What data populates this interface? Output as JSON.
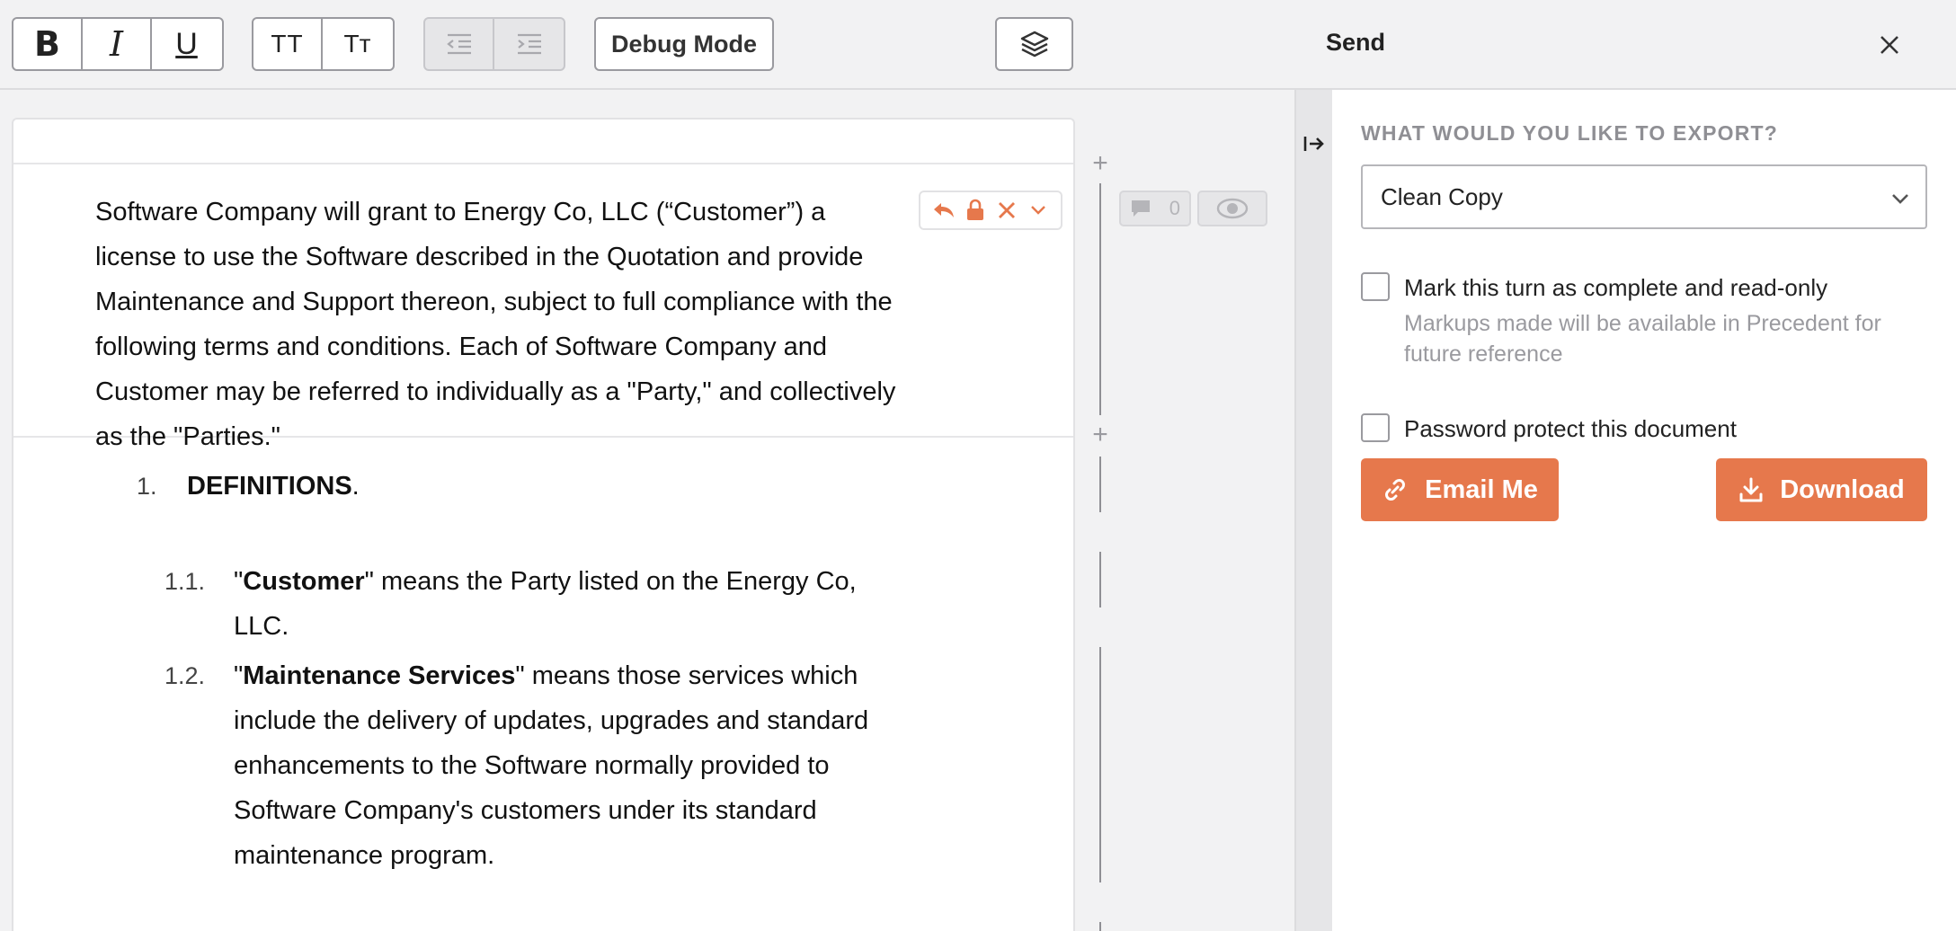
{
  "toolbar": {
    "bold_label": "B",
    "italic_label": "I",
    "underline_label": "U",
    "uppercase_label": "TT",
    "smallcaps_label": "Tт",
    "debug_label": "Debug Mode"
  },
  "document": {
    "intro": "Software Company will grant to Energy Co, LLC (“Customer”) a license to use the Software described in the Quotation and provide Maintenance and Support thereon, subject to full compliance with the following terms and conditions.  Each of Software Company and Customer may be referred to individually as a \"Party,\" and collectively as the \"Parties.\"",
    "section1": {
      "number": "1.",
      "title": "DEFINITIONS",
      "suffix": "."
    },
    "item11": {
      "number": "1.1.",
      "term": "Customer",
      "text": "\" means the Party listed on the Energy Co, LLC."
    },
    "item12": {
      "number": "1.2.",
      "term": "Maintenance Services",
      "text": "\" means those services which include the delivery of updates, upgrades and standard enhancements to the Software normally provided to Software Company's customers under its standard maintenance program."
    },
    "comment_count": "0"
  },
  "panel": {
    "title": "Send",
    "export_label": "WHAT WOULD YOU LIKE TO EXPORT?",
    "export_selected": "Clean Copy",
    "complete_label": "Mark this turn as complete and read-only",
    "complete_help": "Markups made will be available in Precedent for future reference",
    "password_label": "Password protect this document",
    "email_label": "Email Me",
    "download_label": "Download"
  },
  "colors": {
    "accent": "#e6784c",
    "panel_bg": "#f2f2f3",
    "muted_text": "#9a9a9f"
  }
}
